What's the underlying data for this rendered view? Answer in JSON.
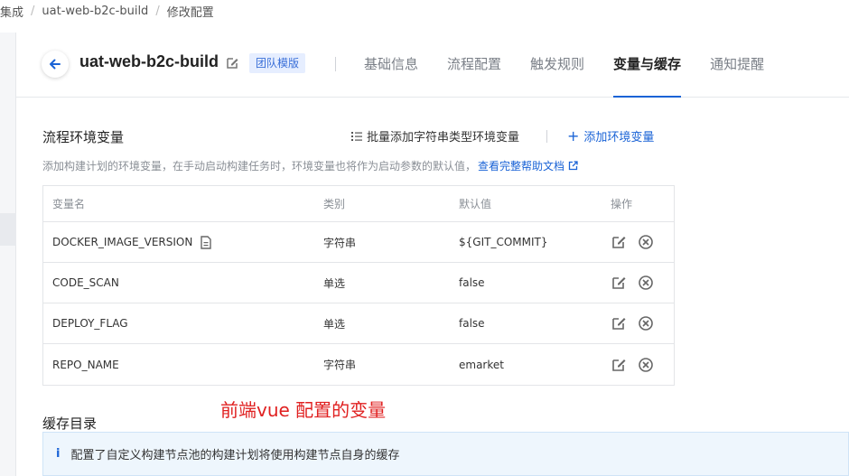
{
  "breadcrumb": {
    "items": [
      "集成",
      "uat-web-b2c-build",
      "修改配置"
    ]
  },
  "header": {
    "plan_name": "uat-web-b2c-build",
    "badge": "团队模版",
    "tabs": [
      {
        "label": "基础信息",
        "active": false
      },
      {
        "label": "流程配置",
        "active": false
      },
      {
        "label": "触发规则",
        "active": false
      },
      {
        "label": "变量与缓存",
        "active": true
      },
      {
        "label": "通知提醒",
        "active": false
      }
    ]
  },
  "env_section": {
    "title": "流程环境变量",
    "batch_add_label": "批量添加字符串类型环境变量",
    "add_label": "添加环境变量",
    "description": "添加构建计划的环境变量，在手动启动构建任务时，环境变量也将作为启动参数的默认值，",
    "help_link": "查看完整帮助文档"
  },
  "table": {
    "headers": {
      "name": "变量名",
      "type": "类别",
      "default": "默认值",
      "ops": "操作"
    },
    "rows": [
      {
        "name": "DOCKER_IMAGE_VERSION",
        "type": "字符串",
        "default": "${GIT_COMMIT}",
        "has_doc_icon": true
      },
      {
        "name": "CODE_SCAN",
        "type": "单选",
        "default": "false"
      },
      {
        "name": "DEPLOY_FLAG",
        "type": "单选",
        "default": "false"
      },
      {
        "name": "REPO_NAME",
        "type": "字符串",
        "default": "emarket"
      }
    ]
  },
  "annotation": {
    "text": "前端vue 配置的变量",
    "color": "#e02020"
  },
  "cache_section": {
    "title": "缓存目录",
    "info": "配置了自定义构建节点池的构建计划将使用构建节点自身的缓存"
  },
  "colors": {
    "accent": "#1a63d6",
    "badge_bg": "#e6eeff",
    "info_bg": "#eef6fd"
  }
}
